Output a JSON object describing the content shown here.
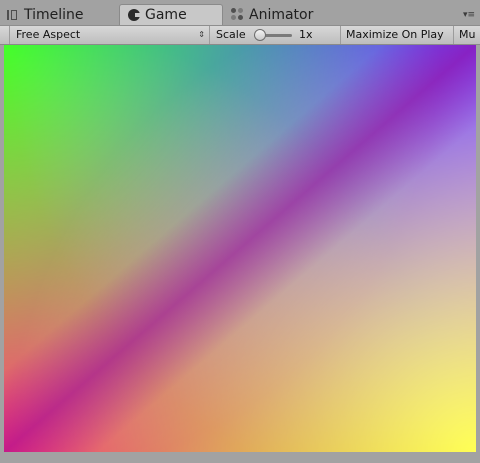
{
  "tabs": [
    {
      "label": "Timeline",
      "icon": "timeline-icon",
      "active": false
    },
    {
      "label": "Game",
      "icon": "game-icon",
      "active": true
    },
    {
      "label": "Animator",
      "icon": "animator-icon",
      "active": false
    }
  ],
  "tab_menu": {
    "icon": "tab-menu-icon",
    "glyph": "▾≡"
  },
  "toolbar": {
    "aspect_label": "Free Aspect",
    "aspect_arrows": "⇕",
    "scale_label": "Scale",
    "scale_value": "1x",
    "scale_level": 0.0,
    "maximize_label": "Maximize On Play",
    "mute_label": "Mu"
  },
  "viewport": {
    "description_colors": {
      "top_left": "#00ff00",
      "top_right": "#0000ff",
      "bottom_left": "#ff0000",
      "bottom_right": "#ffff00"
    }
  }
}
